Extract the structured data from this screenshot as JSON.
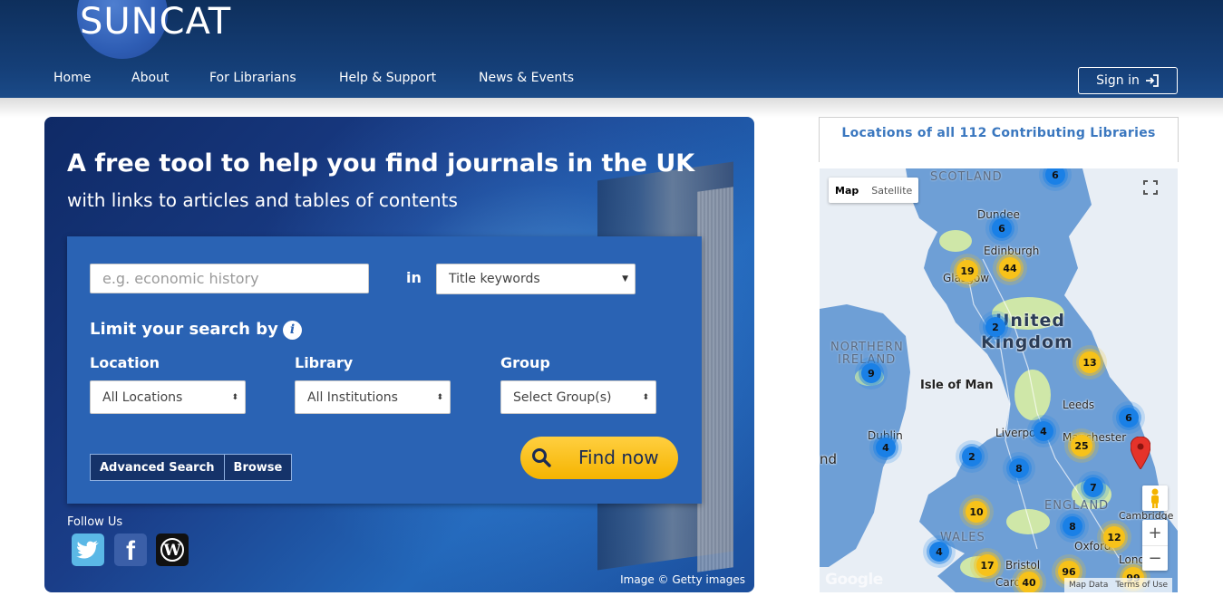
{
  "header": {
    "logo": "SUNCAT",
    "nav": [
      "Home",
      "About",
      "For Librarians",
      "Help & Support",
      "News & Events"
    ],
    "signin_label": "Sign in"
  },
  "hero": {
    "title": "A free tool to help you find journals in the UK",
    "subtitle": "with links to articles and tables of contents",
    "image_credit": "Image © Getty images"
  },
  "search": {
    "placeholder": "e.g. economic history",
    "in_label": "in",
    "field_select": "Title keywords",
    "limit_label": "Limit your search by",
    "filters": {
      "location": {
        "label": "Location",
        "value": "All Locations"
      },
      "library": {
        "label": "Library",
        "value": "All Institutions"
      },
      "group": {
        "label": "Group",
        "value": "Select Group(s)"
      }
    },
    "advanced_label": "Advanced Search",
    "browse_label": "Browse",
    "find_label": "Find now"
  },
  "follow": {
    "label": "Follow Us",
    "networks": [
      "twitter-icon",
      "facebook-icon",
      "wordpress-icon"
    ]
  },
  "map": {
    "title": "Locations of all 112 Contributing Libraries",
    "type_map": "Map",
    "type_satellite": "Satellite",
    "footer_data": "Map Data",
    "footer_terms": "Terms of Use",
    "google_logo": "Google",
    "places": [
      "SCOTLAND",
      "Dundee",
      "Edinburgh",
      "Glasgow",
      "United",
      "Kingdom",
      "NORTHERN",
      "IRELAND",
      "Isle of Man",
      "Leeds",
      "Liverpool",
      "Manchester",
      "Dublin",
      "nd",
      "ENGLAND",
      "WALES",
      "Cambridge",
      "Oxford",
      "Bristol",
      "Lond",
      "Card"
    ],
    "clusters": [
      {
        "count": "6",
        "color": "blue"
      },
      {
        "count": "6",
        "color": "blue"
      },
      {
        "count": "19",
        "color": "yellow"
      },
      {
        "count": "44",
        "color": "yellow"
      },
      {
        "count": "2",
        "color": "blue"
      },
      {
        "count": "9",
        "color": "blue"
      },
      {
        "count": "13",
        "color": "yellow"
      },
      {
        "count": "6",
        "color": "blue"
      },
      {
        "count": "4",
        "color": "blue"
      },
      {
        "count": "25",
        "color": "yellow"
      },
      {
        "count": "4",
        "color": "blue"
      },
      {
        "count": "2",
        "color": "blue"
      },
      {
        "count": "8",
        "color": "blue"
      },
      {
        "count": "7",
        "color": "blue"
      },
      {
        "count": "10",
        "color": "yellow"
      },
      {
        "count": "8",
        "color": "blue"
      },
      {
        "count": "12",
        "color": "yellow"
      },
      {
        "count": "4",
        "color": "blue"
      },
      {
        "count": "17",
        "color": "yellow"
      },
      {
        "count": "96",
        "color": "yellow"
      },
      {
        "count": "40",
        "color": "yellow"
      },
      {
        "count": "99",
        "color": "yellow"
      }
    ],
    "colors": {
      "land": "#6e9fd6",
      "sea": "#e8eef5",
      "green": "#cfe7a8"
    }
  }
}
